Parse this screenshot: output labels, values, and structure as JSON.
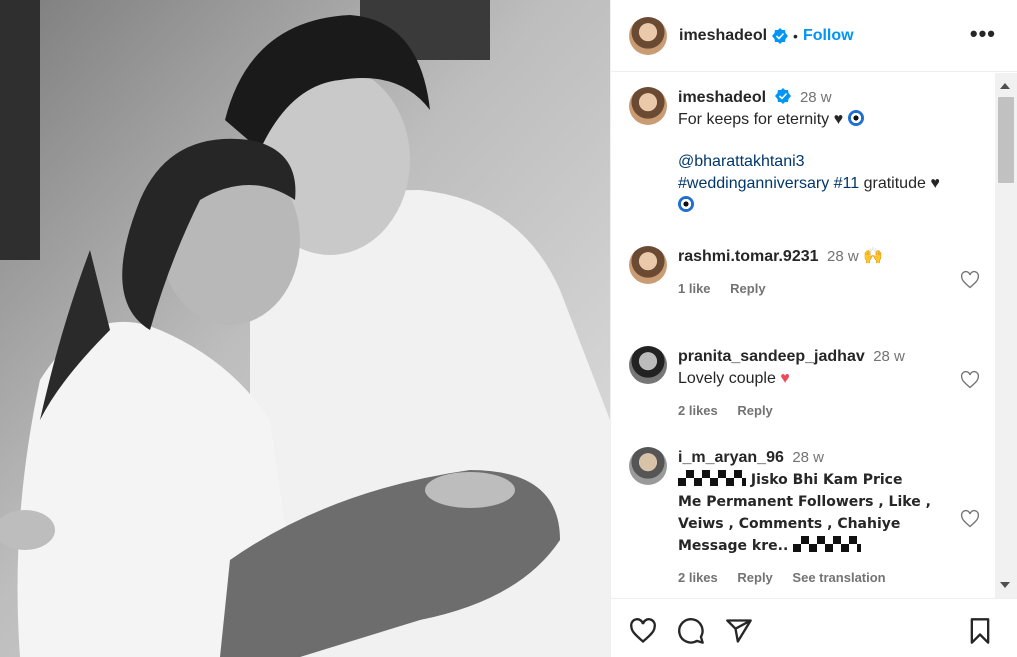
{
  "post": {
    "username": "imeshadeol",
    "follow_label": "Follow",
    "dot": "•",
    "more_label": "•••"
  },
  "caption": {
    "username": "imeshadeol",
    "time": "28 w",
    "line1": "For keeps for eternity ♥",
    "mention": "@bharattakhtani3",
    "hashtags": "#weddinganniversary #11",
    "tail": " gratitude ♥"
  },
  "comments": [
    {
      "username": "rashmi.tomar.9231",
      "time": "28 w",
      "text": "🙌",
      "likes": "1 like",
      "reply": "Reply"
    },
    {
      "username": "pranita_sandeep_jadhav",
      "time": "28 w",
      "text": "Lovely couple",
      "emoji": "♥",
      "likes": "2 likes",
      "reply": "Reply"
    },
    {
      "username": "i_m_aryan_96",
      "time": "28 w",
      "text1": "Jisko Bhi Kam Price",
      "text2": "Me Permanent Followers , Like ,",
      "text3": "Veiws , Comments , Chahiye",
      "text4": "Message kre..",
      "likes": "2 likes",
      "reply": "Reply",
      "translate": "See translation"
    }
  ],
  "colors": {
    "accent": "#0095f6",
    "link": "#00376b",
    "muted": "#737373",
    "heart": "#ed4956"
  },
  "icons": [
    "verified-badge-icon",
    "more-options-icon",
    "heart-icon",
    "comment-icon",
    "share-icon",
    "save-icon"
  ]
}
